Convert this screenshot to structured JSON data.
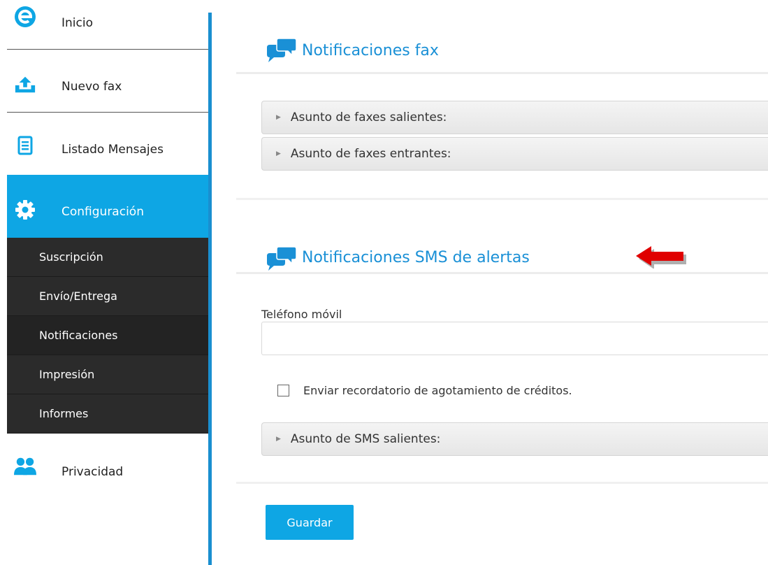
{
  "sidebar": {
    "items": [
      {
        "label": "Inicio",
        "icon": "logo-e-icon"
      },
      {
        "label": "Nuevo fax",
        "icon": "upload-icon"
      },
      {
        "label": "Listado Mensajes",
        "icon": "document-list-icon"
      },
      {
        "label": "Configuración",
        "icon": "gear-icon"
      },
      {
        "label": "Privacidad",
        "icon": "users-icon"
      }
    ],
    "submenu": [
      {
        "label": "Suscripción"
      },
      {
        "label": "Envío/Entrega"
      },
      {
        "label": "Notificaciones"
      },
      {
        "label": "Impresión"
      },
      {
        "label": "Informes"
      }
    ]
  },
  "fax_panel": {
    "title": "Notificaciones fax",
    "accordions": [
      {
        "label": "Asunto de faxes salientes:"
      },
      {
        "label": "Asunto de faxes entrantes:"
      }
    ]
  },
  "sms_panel": {
    "title": "Notificaciones SMS de alertas",
    "phone_label": "Teléfono móvil",
    "phone_value": "",
    "checkbox_label": "Enviar recordatorio de agotamiento de créditos.",
    "checkbox_checked": false,
    "accordion_label": "Asunto de SMS salientes:"
  },
  "actions": {
    "save_label": "Guardar"
  },
  "colors": {
    "accent": "#0ea6e4",
    "title_blue": "#1a90d6",
    "submenu_bg": "#2b2b2b",
    "arrow_red": "#e00000"
  }
}
